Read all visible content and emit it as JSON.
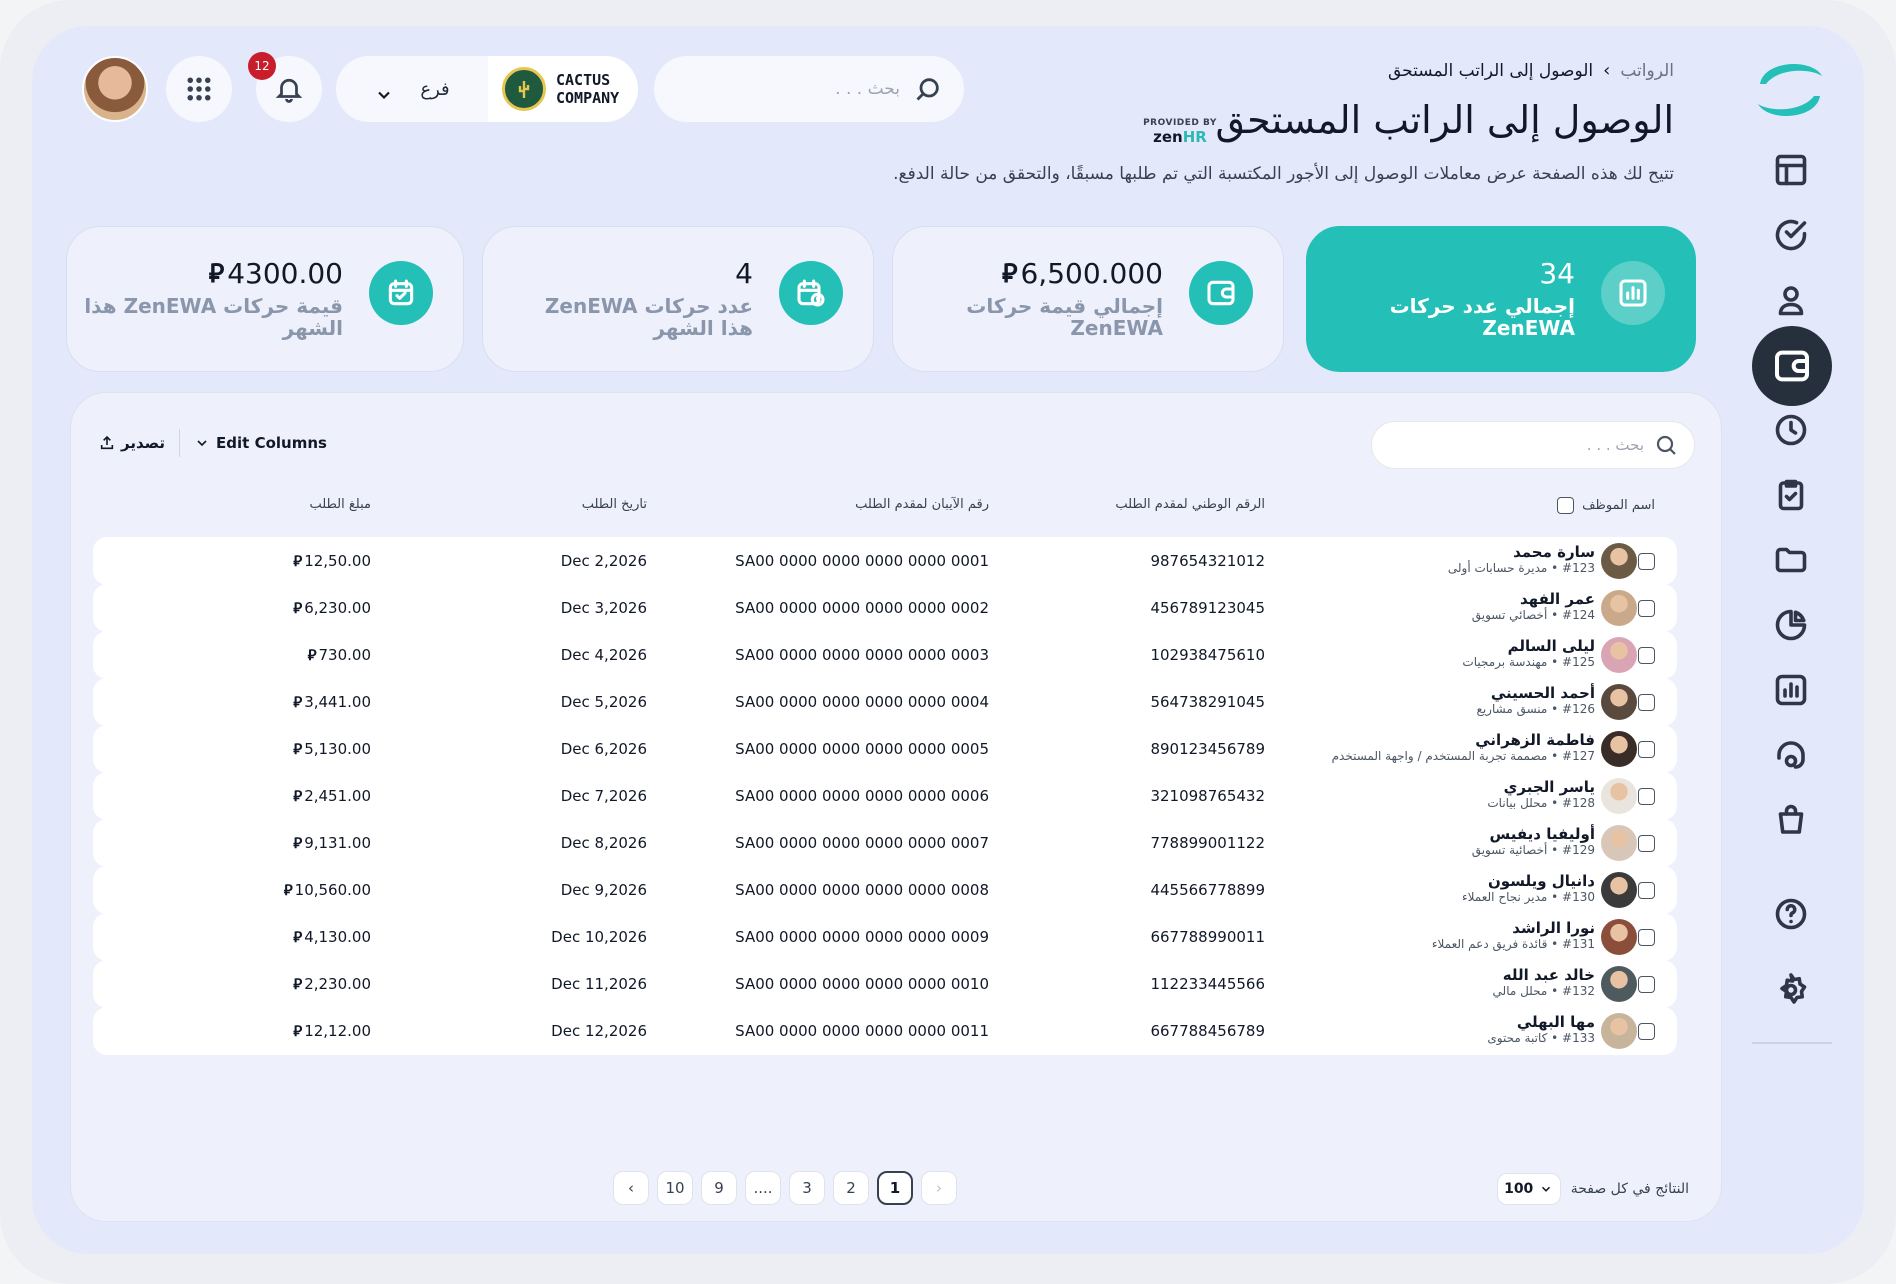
{
  "colors": {
    "accent": "#24bfb6",
    "sidebar_active": "#26303c",
    "badge": "#c81e2c",
    "background": "#e3e8fb"
  },
  "header": {
    "breadcrumb_root": "الرواتب",
    "breadcrumb_current": "الوصول إلى الراتب المستحق",
    "title": "الوصول إلى الراتب المستحق",
    "provided_by": "PROVIDED BY",
    "provider_zen": "zen",
    "provider_hr": "HR",
    "subtitle": "تتيح لك هذه الصفحة عرض معاملات الوصول إلى الأجور المكتسبة التي تم طلبها مسبقًا، والتحقق من حالة الدفع.",
    "search_placeholder": "بحث . . .",
    "branch_label": "فرع",
    "company_line1": "CACTUS",
    "company_line2": "COMPANY",
    "notifications_count": "12"
  },
  "sidebar": {
    "items": [
      "layout-icon",
      "check-circle-icon",
      "user-icon",
      "wallet-icon",
      "clock-icon",
      "clipboard-check-icon",
      "folder-icon",
      "pie-chart-icon",
      "bar-chart-icon",
      "headset-icon",
      "shopping-bag-icon",
      "help-icon",
      "settings-icon"
    ],
    "active": "wallet-icon"
  },
  "cards": [
    {
      "value": "34",
      "label_line1": "إجمالي عدد حركات",
      "label_line2": "ZenEWA",
      "icon": "bar-chart-icon",
      "currency": false
    },
    {
      "value": "6,500.000",
      "label_line1": "إجمالي قيمة حركات",
      "label_line2": "ZenEWA",
      "icon": "wallet-icon",
      "currency": true
    },
    {
      "value": "4",
      "label_line1": "عدد حركات ZenEWA",
      "label_line2": "هذا الشهر",
      "icon": "calendar-clock-icon",
      "currency": false
    },
    {
      "value": "4300.00",
      "label_line1": "قيمة حركات ZenEWA هذا",
      "label_line2": "الشهر",
      "icon": "calendar-check-icon",
      "currency": true
    }
  ],
  "table": {
    "search_placeholder": "بحث . . .",
    "edit_columns": "Edit Columns",
    "export": "تصدير",
    "headers": {
      "name": "اسم الموظف",
      "national_id": "الرقم الوطني لمقدم الطلب",
      "iban": "رقم الآيبان لمقدم الطلب",
      "date": "تاريخ الطلب",
      "amount": "مبلغ الطلب"
    },
    "currency_symbol": "⃁",
    "rows": [
      {
        "name": "سارة محمد",
        "sub": "#123 • مديرة حسابات أولى",
        "national_id": "987654321012",
        "iban": "SA00 0000 0000 0000 0000 0001",
        "date": "Dec 2,2026",
        "amount": "12,50.00"
      },
      {
        "name": "عمر الفهد",
        "sub": "#124 • أخصائي تسويق",
        "national_id": "456789123045",
        "iban": "SA00 0000 0000 0000 0000 0002",
        "date": "Dec 3,2026",
        "amount": "6,230.00"
      },
      {
        "name": "ليلى السالم",
        "sub": "#125 • مهندسة برمجيات",
        "national_id": "102938475610",
        "iban": "SA00 0000 0000 0000 0000 0003",
        "date": "Dec 4,2026",
        "amount": "730.00"
      },
      {
        "name": "أحمد الحسيني",
        "sub": "#126 • منسق مشاريع",
        "national_id": "564738291045",
        "iban": "SA00 0000 0000 0000 0000 0004",
        "date": "Dec 5,2026",
        "amount": "3,441.00"
      },
      {
        "name": "فاطمة الزهراني",
        "sub": "#127 • مصممة تجربة المستخدم / واجهة المستخدم",
        "national_id": "890123456789",
        "iban": "SA00 0000 0000 0000 0000 0005",
        "date": "Dec 6,2026",
        "amount": "5,130.00"
      },
      {
        "name": "ياسر الجبري",
        "sub": "#128 • محلل بيانات",
        "national_id": "321098765432",
        "iban": "SA00 0000 0000 0000 0000 0006",
        "date": "Dec 7,2026",
        "amount": "2,451.00"
      },
      {
        "name": "أوليفيا ديفيس",
        "sub": "#129 • أخصائية تسويق",
        "national_id": "778899001122",
        "iban": "SA00 0000 0000 0000 0000 0007",
        "date": "Dec 8,2026",
        "amount": "9,131.00"
      },
      {
        "name": "دانيال ويلسون",
        "sub": "#130 • مدير نجاح العملاء",
        "national_id": "445566778899",
        "iban": "SA00 0000 0000 0000 0000 0008",
        "date": "Dec 9,2026",
        "amount": "10,560.00"
      },
      {
        "name": "نورا الراشد",
        "sub": "#131 • قائدة فريق دعم العملاء",
        "national_id": "667788990011",
        "iban": "SA00 0000 0000 0000 0000 0009",
        "date": "Dec 10,2026",
        "amount": "4,130.00"
      },
      {
        "name": "خالد عبد الله",
        "sub": "#132 • محلل مالي",
        "national_id": "112233445566",
        "iban": "SA00 0000 0000 0000 0000 0010",
        "date": "Dec 11,2026",
        "amount": "2,230.00"
      },
      {
        "name": "مها البهلي",
        "sub": "#133 • كاتبة محتوى",
        "national_id": "667788456789",
        "iban": "SA00 0000 0000 0000 0000 0011",
        "date": "Dec 12,2026",
        "amount": "12,12.00"
      }
    ]
  },
  "pagination": {
    "pages": [
      "1",
      "2",
      "3",
      "....",
      "9",
      "10"
    ],
    "current": "1",
    "per_page_label": "النتائج في كل صفحة",
    "per_page_value": "100"
  }
}
